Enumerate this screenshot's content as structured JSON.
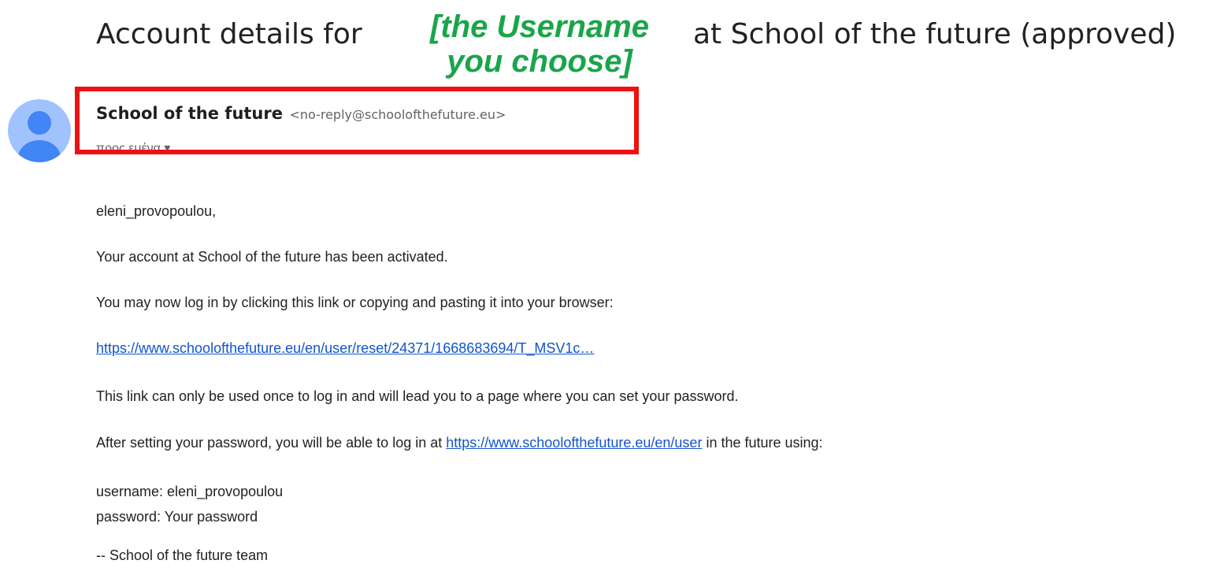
{
  "email": {
    "subject_prefix": "Account details for",
    "subject_suffix": "at School of the future (approved)",
    "sender": {
      "name": "School of the future",
      "email": "<no-reply@schoolofthefuture.eu>"
    },
    "recipient_label": "προς εμένα ▾",
    "greeting": "eleni_provopoulou,",
    "activated_text": "Your account at School of the future has been activated.",
    "login_instruction": "You may now log in by clicking this link or copying and pasting it into your browser:",
    "reset_link": "https://www.schoolofthefuture.eu/en/user/reset/24371/1668683694/T_MSV1c…",
    "once_text": "This link can only be used once to log in and will lead you to a page where you can set your password.",
    "after_text_before_link": "After setting your password, you will be able to log in at",
    "user_link": "https://www.schoolofthefuture.eu/en/user",
    "after_text_after_link": "in the future using:",
    "username_line": "username: eleni_provopoulou",
    "password_line": "password: Your password",
    "signature": "-- School of the future team"
  },
  "annotation": {
    "line1": "[the Username",
    "line2": "you choose]",
    "text_color": "#1aa54a",
    "box_color": "#ee1111"
  },
  "avatar": {
    "icon": "person-icon",
    "bg_color": "#a0c3ff",
    "fg_color": "#4285f4"
  }
}
